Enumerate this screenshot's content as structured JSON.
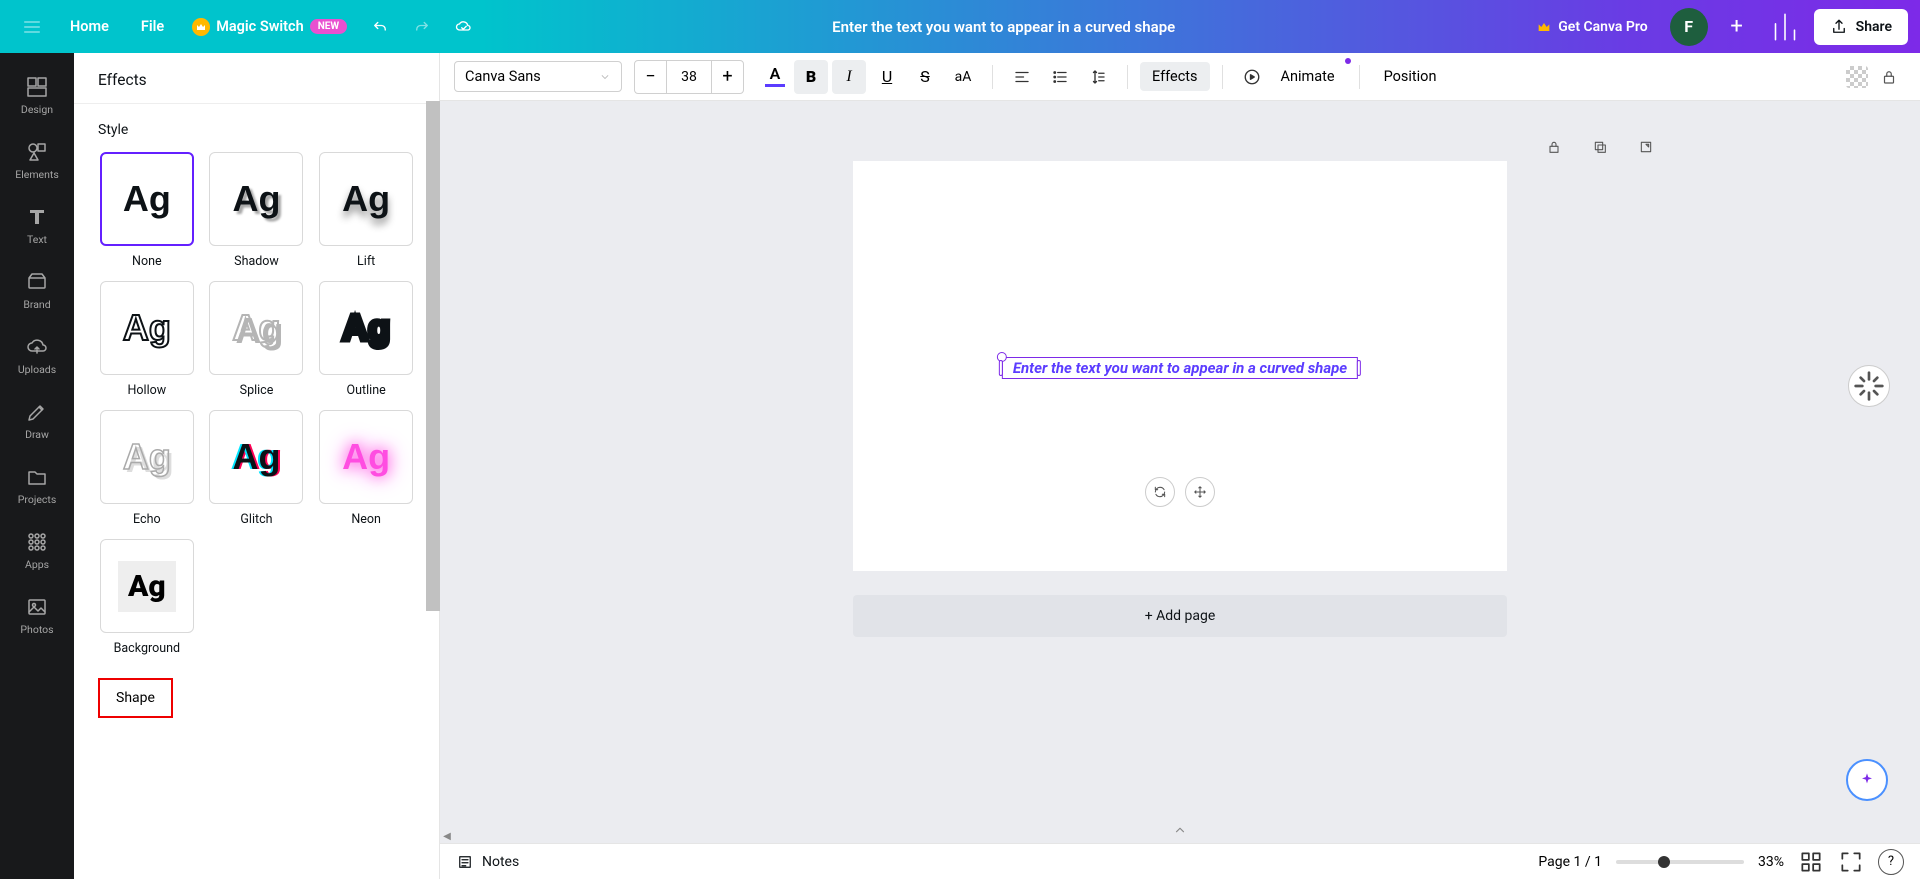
{
  "header": {
    "home": "Home",
    "file": "File",
    "magic_switch": "Magic Switch",
    "new_badge": "NEW",
    "title": "Enter the text you want to appear in a curved shape",
    "get_pro": "Get Canva Pro",
    "avatar_initial": "F",
    "share": "Share"
  },
  "rail": {
    "items": [
      {
        "label": "Design"
      },
      {
        "label": "Elements"
      },
      {
        "label": "Text"
      },
      {
        "label": "Brand"
      },
      {
        "label": "Uploads"
      },
      {
        "label": "Draw"
      },
      {
        "label": "Projects"
      },
      {
        "label": "Apps"
      },
      {
        "label": "Photos"
      }
    ]
  },
  "panel": {
    "title": "Effects",
    "style_section": "Style",
    "shape_section": "Shape",
    "styles": [
      {
        "label": "None"
      },
      {
        "label": "Shadow"
      },
      {
        "label": "Lift"
      },
      {
        "label": "Hollow"
      },
      {
        "label": "Splice"
      },
      {
        "label": "Outline"
      },
      {
        "label": "Echo"
      },
      {
        "label": "Glitch"
      },
      {
        "label": "Neon"
      },
      {
        "label": "Background"
      }
    ]
  },
  "toolbar": {
    "font": "Canva Sans",
    "size": "38",
    "color_letter": "A",
    "bold_glyph": "B",
    "italic_glyph": "I",
    "aa_glyph": "aA",
    "effects": "Effects",
    "animate": "Animate",
    "position": "Position"
  },
  "canvas": {
    "text": "Enter the text you want to appear in a curved shape",
    "add_page": "+ Add page"
  },
  "footer": {
    "notes": "Notes",
    "page": "Page 1 / 1",
    "zoom": "33%",
    "help": "?"
  },
  "colors": {
    "accent": "#7d2ae8",
    "teal": "#00c4cc",
    "text_color": "#5b3cff"
  }
}
